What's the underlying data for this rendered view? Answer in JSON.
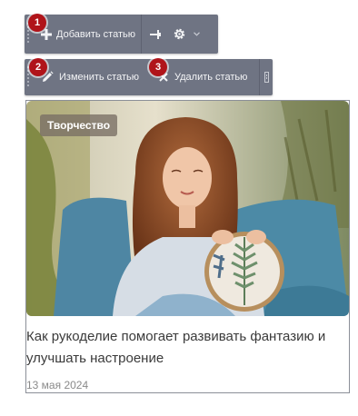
{
  "toolbar_top": {
    "add_label": "Добавить статью",
    "add_icon": "plus-icon",
    "pin_icon": "pin-icon",
    "settings_icon": "gear-icon"
  },
  "toolbar_bottom": {
    "edit_label": "Изменить статью",
    "edit_icon": "pencil-icon",
    "delete_label": "Удалить статью",
    "delete_icon": "close-icon"
  },
  "markers": [
    "1",
    "2",
    "3"
  ],
  "article": {
    "category": "Творчество",
    "title": "Как рукоделие помогает развивать фантазию и улучшать настроение",
    "date": "13 мая 2024"
  },
  "colors": {
    "toolbar": "#6f7483",
    "marker": "#b0141a",
    "badge": "#786e64"
  }
}
